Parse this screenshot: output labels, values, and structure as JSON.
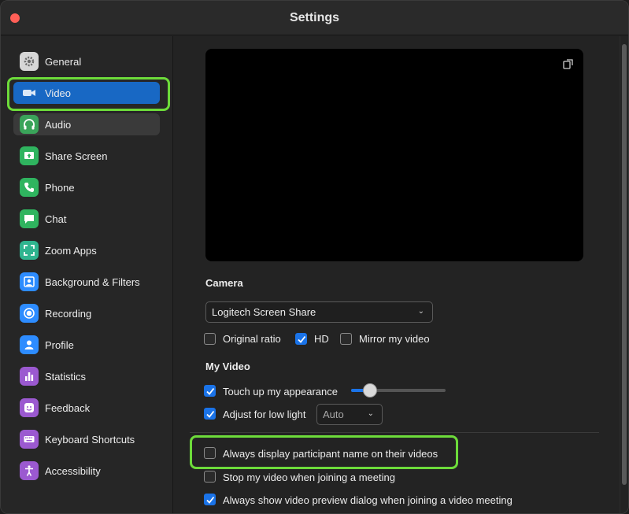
{
  "window": {
    "title": "Settings"
  },
  "sidebar": {
    "items": [
      {
        "label": "General",
        "icon": "gear-icon",
        "color": "#d9d9d9"
      },
      {
        "label": "Video",
        "icon": "video-camera-icon",
        "color": "#1868c4"
      },
      {
        "label": "Audio",
        "icon": "headphones-icon",
        "color": "#3aa45a"
      },
      {
        "label": "Share Screen",
        "icon": "share-screen-icon",
        "color": "#2fb45f"
      },
      {
        "label": "Phone",
        "icon": "phone-icon",
        "color": "#2fb45f"
      },
      {
        "label": "Chat",
        "icon": "chat-icon",
        "color": "#2fb45f"
      },
      {
        "label": "Zoom Apps",
        "icon": "apps-icon",
        "color": "#2fb48f"
      },
      {
        "label": "Background & Filters",
        "icon": "background-icon",
        "color": "#2d8cff"
      },
      {
        "label": "Recording",
        "icon": "record-icon",
        "color": "#2d8cff"
      },
      {
        "label": "Profile",
        "icon": "profile-icon",
        "color": "#2d8cff"
      },
      {
        "label": "Statistics",
        "icon": "statistics-icon",
        "color": "#9b59d0"
      },
      {
        "label": "Feedback",
        "icon": "feedback-icon",
        "color": "#9b59d0"
      },
      {
        "label": "Keyboard Shortcuts",
        "icon": "keyboard-icon",
        "color": "#9b59d0"
      },
      {
        "label": "Accessibility",
        "icon": "accessibility-icon",
        "color": "#9b59d0"
      }
    ],
    "active": "Video"
  },
  "video": {
    "camera_title": "Camera",
    "camera_select": "Logitech Screen Share",
    "options": {
      "original_ratio": {
        "label": "Original ratio",
        "checked": false
      },
      "hd": {
        "label": "HD",
        "checked": true
      },
      "mirror": {
        "label": "Mirror my video",
        "checked": false
      }
    },
    "my_video_title": "My Video",
    "touch_up": {
      "label": "Touch up my appearance",
      "checked": true,
      "level": 0.2
    },
    "low_light": {
      "label": "Adjust for low light",
      "checked": true,
      "mode": "Auto"
    },
    "always_display": {
      "label": "Always display participant name on their videos",
      "checked": false
    },
    "stop_video": {
      "label": "Stop my video when joining a meeting",
      "checked": false
    },
    "show_preview": {
      "label": "Always show video preview dialog when joining a video meeting",
      "checked": true
    }
  },
  "colors": {
    "accent": "#1a73e8",
    "highlight": "#6ddb3a"
  }
}
